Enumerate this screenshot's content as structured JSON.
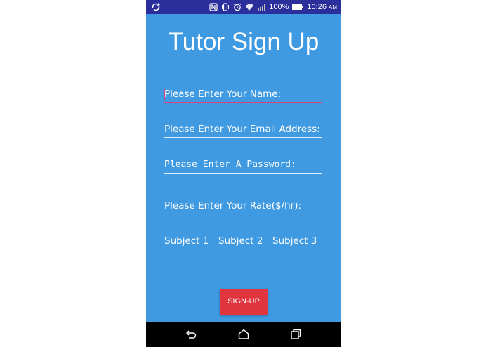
{
  "status_bar": {
    "battery_percent": "100%",
    "time": "10:26",
    "ampm": "AM",
    "icons": [
      "sync-icon",
      "nfc-icon",
      "vibrate-icon",
      "alarm-icon",
      "wifi-icon",
      "signal-icon",
      "battery-icon"
    ]
  },
  "title": "Tutor Sign Up",
  "form": {
    "name_placeholder": "Please Enter Your Name:",
    "email_placeholder": "Please Enter Your Email Address:",
    "password_placeholder": "Please Enter A Password:",
    "rate_placeholder": "Please Enter Your Rate($/hr):",
    "subjects": [
      "Subject 1",
      "Subject 2",
      "Subject 3"
    ]
  },
  "signup_button": "SIGN-UP",
  "nav": {
    "icons": [
      "back-icon",
      "home-icon",
      "recents-icon"
    ]
  },
  "colors": {
    "background": "#3f9ae2",
    "status_bar": "#2b2f9c",
    "button": "#e0353f",
    "focus_line": "#e0407a"
  }
}
